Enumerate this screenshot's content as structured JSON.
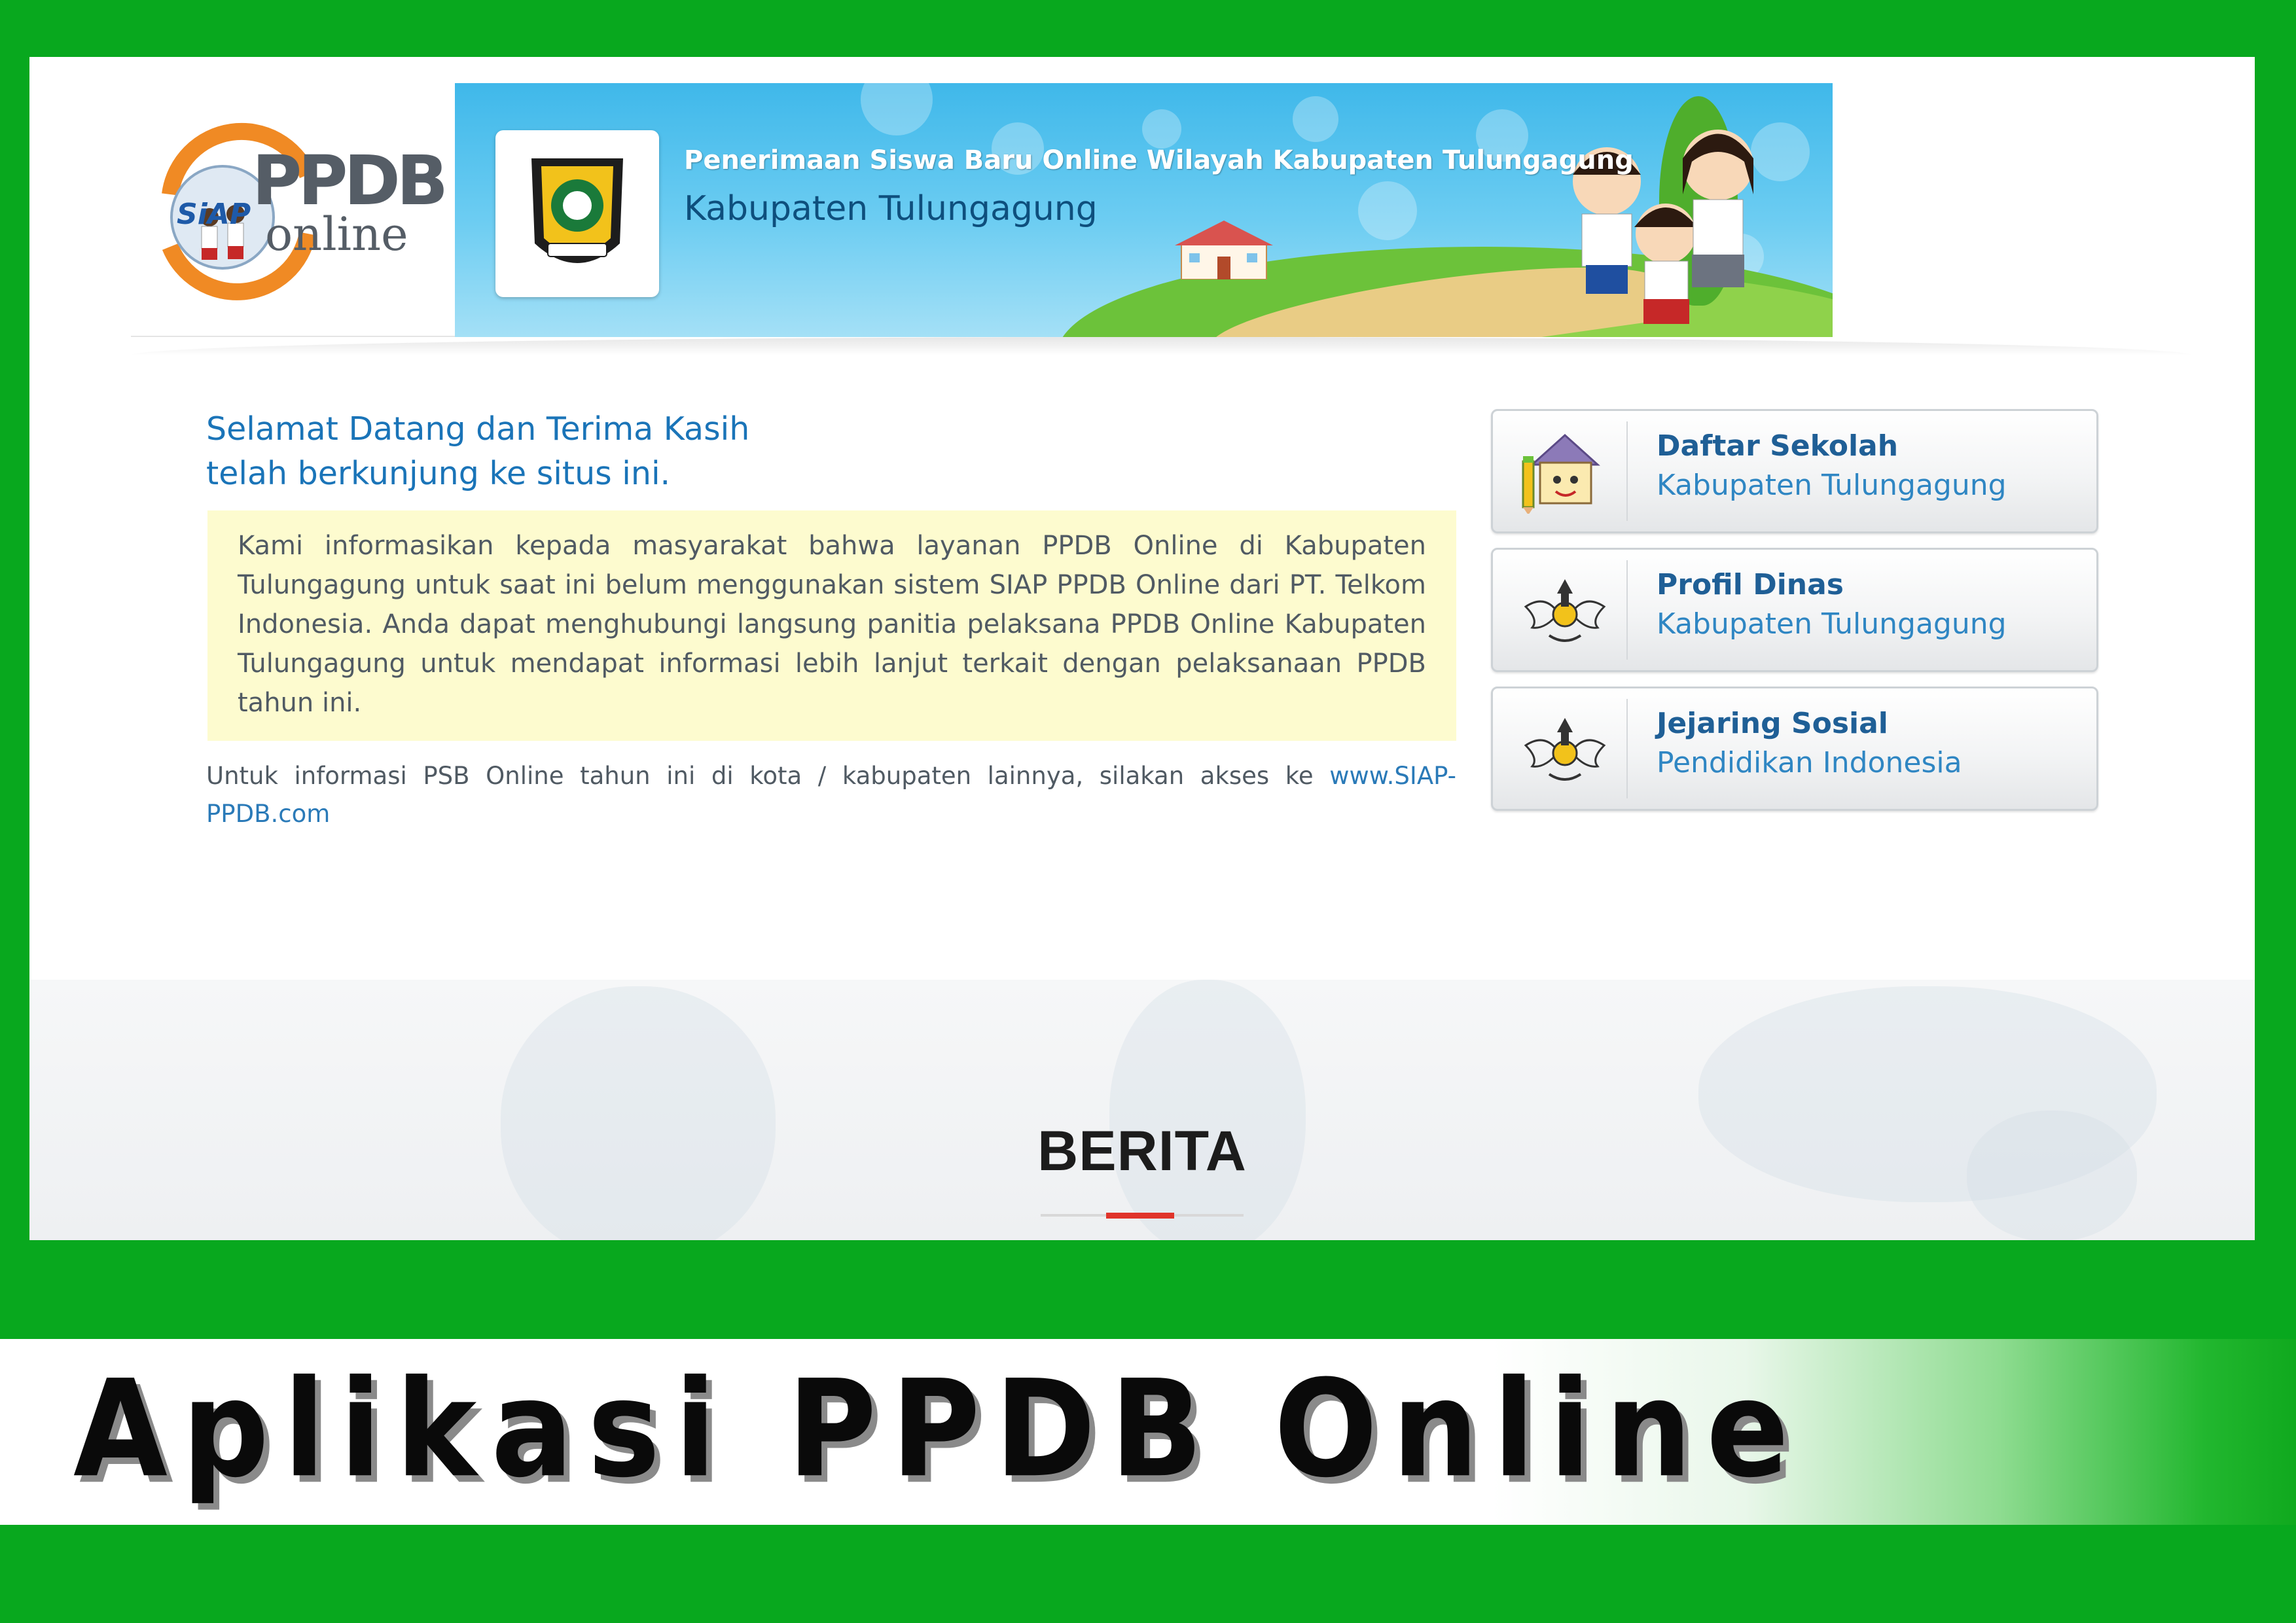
{
  "banner": {
    "logo_text_top": "PPDB",
    "logo_text_bottom": "online",
    "logo_badge": "SiAP",
    "line1": "Penerimaan Siswa Baru Online Wilayah Kabupaten Tulungagung",
    "line2": "Kabupaten Tulungagung"
  },
  "welcome": {
    "title_line1": "Selamat Datang dan Terima Kasih",
    "title_line2": "telah berkunjung ke situs ini.",
    "info": "Kami informasikan kepada masyarakat bahwa layanan PPDB Online di Kabupaten Tulungagung untuk saat ini belum menggunakan sistem SIAP PPDB Online dari PT. Telkom Indonesia. Anda dapat menghubungi langsung panitia pelaksana PPDB Online Kabupaten Tulungagung untuk mendapat informasi lebih lanjut terkait dengan pelaksanaan PPDB tahun ini.",
    "note_prefix": "Untuk informasi PSB Online tahun ini di kota / kabupaten lainnya, silakan akses ke ",
    "note_link": "www.SIAP-PPDB.com"
  },
  "side_buttons": [
    {
      "title": "Daftar Sekolah",
      "subtitle": "Kabupaten Tulungagung",
      "icon": "school-house-icon"
    },
    {
      "title": "Profil Dinas",
      "subtitle": "Kabupaten Tulungagung",
      "icon": "tut-wuri-emblem-icon"
    },
    {
      "title": "Jejaring Sosial",
      "subtitle": "Pendidikan Indonesia",
      "icon": "tut-wuri-emblem-icon"
    }
  ],
  "news": {
    "title": "BERITA"
  },
  "caption": "Aplikasi PPDB Online",
  "colors": {
    "frame_green": "#08a81e",
    "link_blue": "#1a74b8",
    "info_bg": "#fdfbcf",
    "accent_red": "#e0342a"
  }
}
